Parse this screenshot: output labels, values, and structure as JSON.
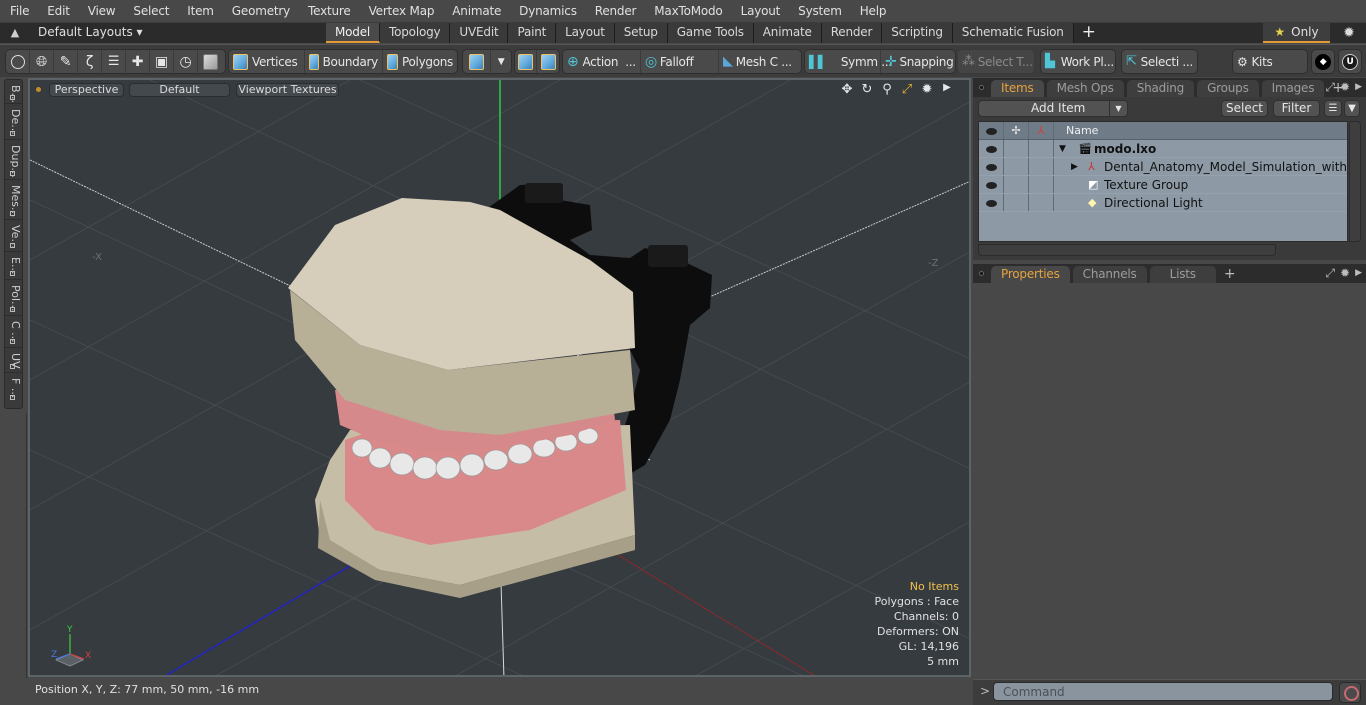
{
  "menubar": [
    "File",
    "Edit",
    "View",
    "Select",
    "Item",
    "Geometry",
    "Texture",
    "Vertex Map",
    "Animate",
    "Dynamics",
    "Render",
    "MaxToModo",
    "Layout",
    "System",
    "Help"
  ],
  "layoutbar": {
    "layouts_label": "Default Layouts ▾",
    "tabs": [
      "Model",
      "Topology",
      "UVEdit",
      "Paint",
      "Layout",
      "Setup",
      "Game Tools",
      "Animate",
      "Render",
      "Scripting",
      "Schematic Fusion"
    ],
    "active_tab": "Model",
    "add_tab": "+",
    "only_label": "Only"
  },
  "toolbar": {
    "vertices": "Vertices",
    "boundary": "Boundary",
    "polygons": "Polygons",
    "action": "Action",
    "action_more": "...",
    "falloff": "Falloff",
    "mesh_c": "Mesh C ...",
    "symm": "Symm ...",
    "snapping": "Snapping",
    "select_t": "Select T...",
    "work_pl": "Work Pl...",
    "selecti": "Selecti ...",
    "kits": "Kits"
  },
  "left_strip": [
    "B...",
    "De...",
    "Dup...",
    "Mes...",
    "Ve...",
    "E...",
    "Pol...",
    "C ...",
    "UV",
    "F ..."
  ],
  "viewport": {
    "view_mode": "Perspective",
    "shading": "Default",
    "textures": "Viewport Textures",
    "axis_neg_x": "-X",
    "axis_neg_z": "-Z",
    "info": {
      "selection": "No Items",
      "polygons": "Polygons : Face",
      "channels": "Channels: 0",
      "deformers": "Deformers: ON",
      "gl": "GL: 14,196",
      "grid": "5 mm"
    },
    "gizmo": {
      "x": "X",
      "y": "Y",
      "z": "Z"
    }
  },
  "statusbar": {
    "position": "Position X, Y, Z:   77 mm, 50 mm, -16 mm"
  },
  "items_panel": {
    "tabs": [
      "Items",
      "Mesh Ops",
      "Shading",
      "Groups",
      "Images"
    ],
    "active_tab": "Items",
    "add_tab": "+",
    "add_item": "Add Item",
    "select": "Select",
    "filter": "Filter",
    "column_name": "Name",
    "rows": [
      {
        "name": "modo.lxo",
        "bold": true,
        "type": "scene"
      },
      {
        "name": "Dental_Anatomy_Model_Simulation_with_Remo ...",
        "type": "mesh"
      },
      {
        "name": "Texture Group",
        "type": "texture-group"
      },
      {
        "name": "Directional Light",
        "type": "light"
      }
    ]
  },
  "properties_panel": {
    "tabs": [
      "Properties",
      "Channels",
      "Lists"
    ],
    "active_tab": "Properties",
    "add_tab": "+"
  },
  "command": {
    "prompt": ">",
    "placeholder": "Command"
  },
  "colors": {
    "accent": "#e39a36",
    "viewport_bg": "#363b40",
    "tree_bg": "#8d9aa6"
  }
}
